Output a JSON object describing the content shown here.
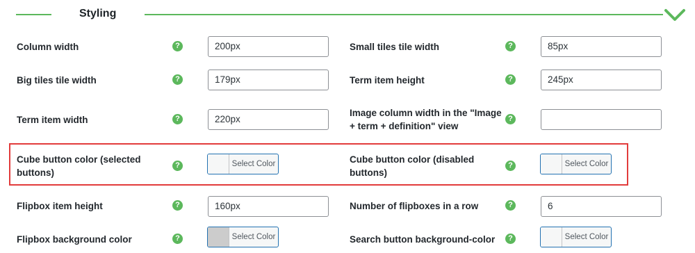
{
  "section": {
    "title": "Styling",
    "accent_color": "#5cb85c",
    "toggle_icon": "chevron-down-icon"
  },
  "help_glyph": "?",
  "rows": [
    {
      "left": {
        "label": "Column width",
        "type": "text",
        "value": "200px"
      },
      "right": {
        "label": "Small tiles tile width",
        "type": "text",
        "value": "85px"
      }
    },
    {
      "left": {
        "label": "Big tiles tile width",
        "type": "text",
        "value": "179px"
      },
      "right": {
        "label": "Term item height",
        "type": "text",
        "value": "245px"
      }
    },
    {
      "left": {
        "label": "Term item width",
        "type": "text",
        "value": "220px"
      },
      "right": {
        "label": "Image column width in the \"Image + term + definition\" view",
        "type": "text",
        "value": ""
      }
    },
    {
      "left": {
        "label": "Cube button color (selected buttons)",
        "type": "color",
        "button_label": "Select Color",
        "swatch": "#f6f7f7"
      },
      "right": {
        "label": "Cube button color (disabled buttons)",
        "type": "color",
        "button_label": "Select Color",
        "swatch": "#f6f7f7"
      }
    },
    {
      "left": {
        "label": "Flipbox item height",
        "type": "text",
        "value": "160px"
      },
      "right": {
        "label": "Number of flipboxes in a row",
        "type": "text",
        "value": "6"
      }
    },
    {
      "left": {
        "label": "Flipbox background color",
        "type": "color",
        "button_label": "Select Color",
        "swatch": "#cccccc"
      },
      "right": {
        "label": "Search button background-color",
        "type": "color",
        "button_label": "Select Color",
        "swatch": "#f6f7f7"
      }
    }
  ],
  "highlight_color": "#e23b3b"
}
